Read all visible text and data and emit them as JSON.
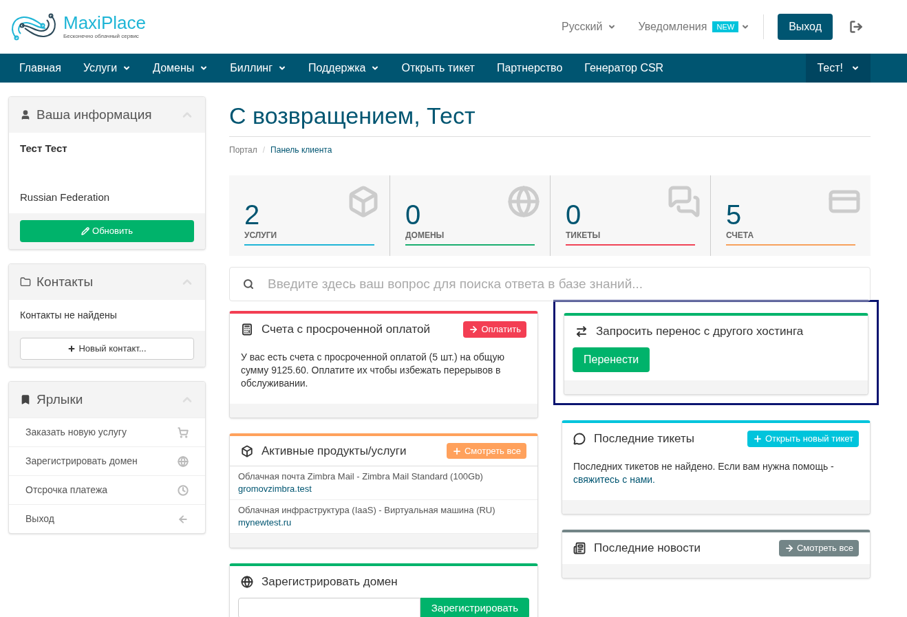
{
  "logo": {
    "name": "MaxiPlace",
    "tagline": "Бесконечно облачный сервис"
  },
  "topbar": {
    "language": "Русский",
    "notifications": "Уведомления",
    "notifications_badge": "NEW",
    "logout": "Выход"
  },
  "nav": {
    "items": [
      {
        "label": "Главная",
        "dropdown": false
      },
      {
        "label": "Услуги",
        "dropdown": true
      },
      {
        "label": "Домены",
        "dropdown": true
      },
      {
        "label": "Биллинг",
        "dropdown": true
      },
      {
        "label": "Поддержка",
        "dropdown": true
      },
      {
        "label": "Открыть тикет",
        "dropdown": false
      },
      {
        "label": "Партнерство",
        "dropdown": false
      },
      {
        "label": "Генератор CSR",
        "dropdown": false
      }
    ],
    "user": "Тест!"
  },
  "sidebar": {
    "info": {
      "title": "Ваша информация",
      "name": "Тест Тест",
      "country": "Russian Federation",
      "button": "Обновить"
    },
    "contacts": {
      "title": "Контакты",
      "empty": "Контакты не найдены",
      "button": "Новый контакт..."
    },
    "shortcuts": {
      "title": "Ярлыки",
      "items": [
        "Заказать новую услугу",
        "Зарегистрировать домен",
        "Отсрочка платежа",
        "Выход"
      ]
    }
  },
  "heading": "С возвращением, Тест",
  "breadcrumb_separator": "/",
  "breadcrumb": [
    {
      "label": "Портал",
      "selected": false
    },
    {
      "label": "Панель клиента",
      "selected": true
    }
  ],
  "stats": [
    {
      "value": "2",
      "label": "УСЛУГИ",
      "color": "#1fb5d6"
    },
    {
      "value": "0",
      "label": "ДОМЕНЫ",
      "color": "#1aae6f"
    },
    {
      "value": "0",
      "label": "ТИКЕТЫ",
      "color": "#f04356"
    },
    {
      "value": "5",
      "label": "СЧЕТА",
      "color": "#f7a15c"
    }
  ],
  "search": {
    "placeholder": "Введите здесь ваш вопрос для поиска ответа в базе знаний..."
  },
  "panels_left": [
    {
      "kind": "text",
      "title": "Счета с просроченной оплатой",
      "color": "#f33e53",
      "button": "Оплатить",
      "text": "У вас есть счета с просроченной оплатой (5 шт.) на общую сумму 9125.60. Оплатите их чтобы избежать перерывов в обслуживании."
    },
    {
      "kind": "list",
      "title": "Активные продукты/услуги",
      "color": "#ffa15c",
      "button": "Смотреть все",
      "items": [
        {
          "product": "Облачная почта Zimbra Mail - Zimbra Mail Standard (100Gb)",
          "domain": "gromovzimbra.test"
        },
        {
          "product": "Облачная инфраструктура (IaaS) - Виртуальная машина (RU)",
          "domain": "mynewtest.ru"
        }
      ]
    },
    {
      "kind": "domain",
      "title": "Зарегистрировать домен",
      "color": "#00b36b",
      "button": "Зарегистрировать"
    }
  ],
  "panels_right": [
    {
      "kind": "action",
      "title": "Запросить перенос с другого хостинга",
      "color": "#00b36b",
      "button": "Перенести",
      "highlighted": true
    },
    {
      "kind": "text",
      "title": "Последние тикеты",
      "color": "#00c4dc",
      "button": "Открыть новый тикет",
      "text": "Последних тикетов не найдено. Если вам нужна помощь - ",
      "link": "свяжитесь с нами."
    },
    {
      "kind": "empty",
      "title": "Последние новости",
      "color": "#738587",
      "button": "Смотреть все"
    }
  ]
}
